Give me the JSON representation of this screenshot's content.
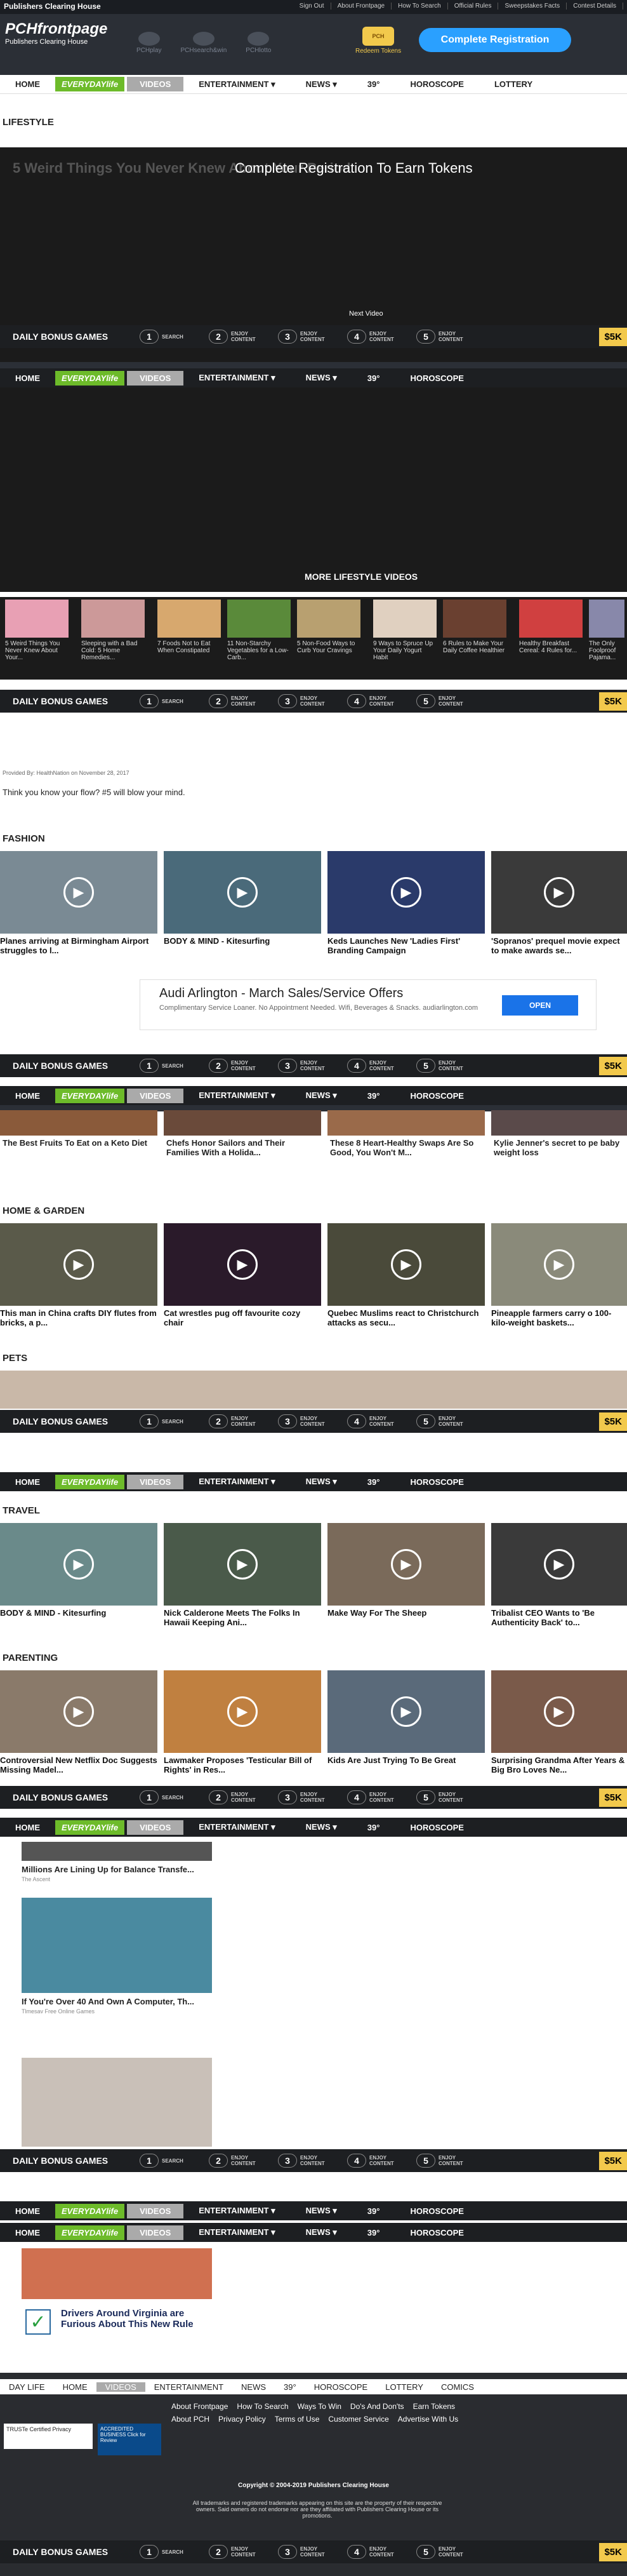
{
  "topbar": {
    "brand": "Publishers Clearing House",
    "links": [
      "Sign Out",
      "About Frontpage",
      "How To Search",
      "Official Rules",
      "Sweepstakes Facts",
      "Contest Details"
    ]
  },
  "header": {
    "logo": "PCHfrontpage",
    "logo_sub": "Publishers Clearing House",
    "icons": [
      "PCHplay",
      "PCHsearch&win",
      "PCHlotto"
    ],
    "tokens_label": "Redeem Tokens",
    "register_label": "Complete Registration"
  },
  "nav": {
    "items": [
      "HOME",
      "EVERYDAYlife",
      "VIDEOS",
      "ENTERTAINMENT ▾",
      "NEWS ▾",
      "39°",
      "HOROSCOPE",
      "LOTTERY"
    ]
  },
  "lifestyle": {
    "title": "LIFESTYLE",
    "video_title": "5 Weird Things You Never Knew About Your Period",
    "overlay": "Complete Registration To Earn Tokens",
    "next": "Next Video",
    "more": "MORE LIFESTYLE VIDEOS",
    "thumbs": [
      "5 Weird Things You Never Knew About Your...",
      "Sleeping with a Bad Cold: 5 Home Remedies...",
      "7 Foods Not to Eat When Constipated",
      "11 Non-Starchy Vegetables for a Low-Carb...",
      "5 Non-Food Ways to Curb Your Cravings",
      "9 Ways to Spruce Up Your Daily Yogurt Habit",
      "6 Rules to Make Your Daily Coffee Healthier",
      "Healthy Breakfast Cereal: 4 Rules for...",
      "The Only Foolproof Pajama..."
    ],
    "provided": "Provided By: HealthNation on November 28, 2017",
    "desc": "Think you know your flow? #5 will blow your mind."
  },
  "bonus": {
    "title": "DAILY BONUS GAMES",
    "steps": [
      {
        "n": "1",
        "l": "SEARCH"
      },
      {
        "n": "2",
        "l": "ENJOY CONTENT"
      },
      {
        "n": "3",
        "l": "ENJOY CONTENT"
      },
      {
        "n": "4",
        "l": "ENJOY CONTENT"
      },
      {
        "n": "5",
        "l": "ENJOY CONTENT"
      }
    ],
    "prize": "$5K"
  },
  "fashion": {
    "title": "FASHION",
    "cards": [
      "Planes arriving at Birmingham Airport struggles to l...",
      "BODY & MIND - Kitesurfing",
      "Keds Launches New 'Ladies First' Branding Campaign",
      "'Sopranos' prequel movie expect to make awards se..."
    ]
  },
  "ad": {
    "title": "Audi Arlington - March Sales/Service Offers",
    "body": "Complimentary Service Loaner. No Appointment Needed. Wifi, Beverages & Snacks. audiarlington.com",
    "cta": "OPEN"
  },
  "food": {
    "cards": [
      "The Best Fruits To Eat on a Keto Diet",
      "Chefs Honor Sailors and Their Families With a Holida...",
      "These 8 Heart-Healthy Swaps Are So Good, You Won't M...",
      "Kylie Jenner's secret to pe baby weight loss"
    ]
  },
  "home": {
    "title": "HOME & GARDEN",
    "cards": [
      "This man in China crafts DIY flutes from bricks, a p...",
      "Cat wrestles pug off favourite cozy chair",
      "Quebec Muslims react to Christchurch attacks as secu...",
      "Pineapple farmers carry o 100-kilo-weight baskets..."
    ]
  },
  "pets": {
    "title": "PETS"
  },
  "travel": {
    "title": "TRAVEL",
    "cards": [
      "BODY & MIND - Kitesurfing",
      "Nick Calderone Meets The Folks In Hawaii Keeping Ani...",
      "Make Way For The Sheep",
      "Tribalist CEO Wants to 'Be Authenticity Back' to..."
    ]
  },
  "parenting": {
    "title": "PARENTING",
    "cards": [
      "Controversial New Netflix Doc Suggests Missing Madel...",
      "Lawmaker Proposes 'Testicular Bill of Rights' in Res...",
      "Kids Are Just Trying To Be Great",
      "Surprising Grandma After Years & Big Bro Loves Ne..."
    ]
  },
  "sponsored": [
    {
      "title": "Millions Are Lining Up for Balance Transfe...",
      "src": "The Ascent"
    },
    {
      "title": "If You're Over 40 And Own A Computer, Th...",
      "src": "Tlmesav Free Online Games"
    },
    {
      "title": "Drivers Around Virginia are Furious About This New Rule",
      "src": ""
    }
  ],
  "footer": {
    "nav": [
      "DAY LIFE",
      "HOME",
      "VIDEOS",
      "ENTERTAINMENT",
      "NEWS",
      "39°",
      "HOROSCOPE",
      "LOTTERY",
      "COMICS"
    ],
    "links1": [
      "About Frontpage",
      "How To Search",
      "Ways To Win",
      "Do's And Don'ts",
      "Earn Tokens"
    ],
    "links2": [
      "About PCH",
      "Privacy Policy",
      "Terms of Use",
      "Customer Service",
      "Advertise With Us"
    ],
    "copyright": "Copyright © 2004-2019 Publishers Clearing House",
    "legal": "All trademarks and registered trademarks appearing on this site are the property of their respective owners. Said owners do not endorse nor are they affiliated with Publishers Clearing House or its promotions.",
    "badge1": "TRUSTe Certified Privacy",
    "badge2": "ACCREDITED BUSINESS Click for Review"
  }
}
